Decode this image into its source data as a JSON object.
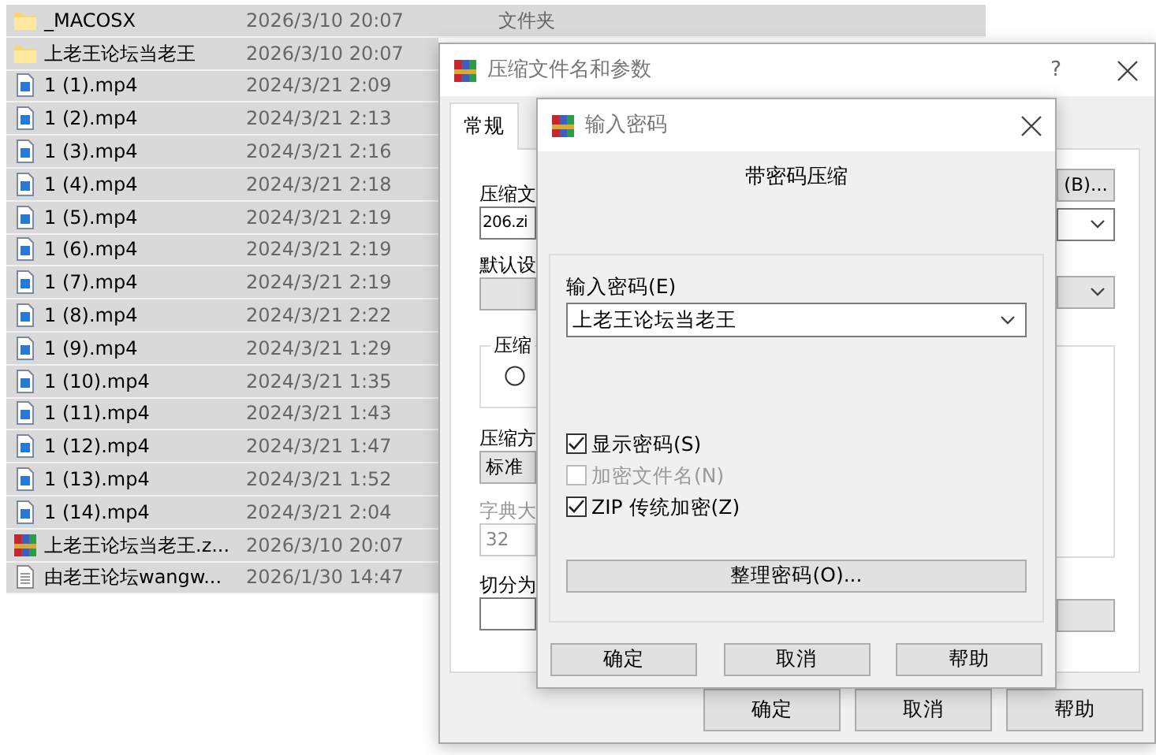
{
  "file_list": {
    "rows": [
      {
        "kind": "folder",
        "name": "_MACOSX",
        "modified": "2026/3/10 20:07",
        "type": "文件夹",
        "selected": true
      },
      {
        "kind": "folder",
        "name": "上老王论坛当老王",
        "modified": "2026/3/10 20:07",
        "selected": true
      },
      {
        "kind": "video",
        "name": "1 (1).mp4",
        "modified": "2024/3/21 2:09",
        "selected": true
      },
      {
        "kind": "video",
        "name": "1 (2).mp4",
        "modified": "2024/3/21 2:13",
        "selected": true
      },
      {
        "kind": "video",
        "name": "1 (3).mp4",
        "modified": "2024/3/21 2:16",
        "selected": true
      },
      {
        "kind": "video",
        "name": "1 (4).mp4",
        "modified": "2024/3/21 2:18",
        "selected": true
      },
      {
        "kind": "video",
        "name": "1 (5).mp4",
        "modified": "2024/3/21 2:19",
        "selected": true
      },
      {
        "kind": "video",
        "name": "1 (6).mp4",
        "modified": "2024/3/21 2:19",
        "selected": true
      },
      {
        "kind": "video",
        "name": "1 (7).mp4",
        "modified": "2024/3/21 2:19",
        "selected": true
      },
      {
        "kind": "video",
        "name": "1 (8).mp4",
        "modified": "2024/3/21 2:22",
        "selected": true
      },
      {
        "kind": "video",
        "name": "1 (9).mp4",
        "modified": "2024/3/21 1:29",
        "selected": true
      },
      {
        "kind": "video",
        "name": "1 (10).mp4",
        "modified": "2024/3/21 1:35",
        "selected": true
      },
      {
        "kind": "video",
        "name": "1 (11).mp4",
        "modified": "2024/3/21 1:43",
        "selected": true
      },
      {
        "kind": "video",
        "name": "1 (12).mp4",
        "modified": "2024/3/21 1:47",
        "selected": true
      },
      {
        "kind": "video",
        "name": "1 (13).mp4",
        "modified": "2024/3/21 1:52",
        "selected": true
      },
      {
        "kind": "video",
        "name": "1 (14).mp4",
        "modified": "2024/3/21 2:04",
        "selected": true
      },
      {
        "kind": "archive",
        "name": "上老王论坛当老王.z...",
        "modified": "2026/3/10 20:07",
        "selected": true
      },
      {
        "kind": "text",
        "name": "由老王论坛wangw...",
        "modified": "2026/1/30 14:47",
        "selected": true
      }
    ]
  },
  "archive_dialog": {
    "title": "压缩文件名和参数",
    "help_button": "?",
    "tabs": [
      {
        "label": "常规",
        "selected": true
      }
    ],
    "archive_name_label": "压缩文",
    "archive_name_value": "206.zi",
    "browse_button": "(B)...",
    "profile_label": "默认设",
    "format_group_label": "压缩",
    "format_radio": {
      "selected": false
    },
    "method_label": "压缩方",
    "method_value": "标准",
    "dictionary_label": "字典大",
    "dictionary_value": "32",
    "dictionary_disabled": true,
    "split_label": "切分为",
    "buttons": [
      "确定",
      "取消",
      "帮助"
    ]
  },
  "password_dialog": {
    "title": "输入密码",
    "heading": "带密码压缩",
    "password_label": "输入密码(E)",
    "password_value": "上老王论坛当老王",
    "options": [
      {
        "label": "显示密码(S)",
        "checked": true,
        "disabled": false
      },
      {
        "label": "加密文件名(N)",
        "checked": false,
        "disabled": true
      },
      {
        "label": "ZIP 传统加密(Z)",
        "checked": true,
        "disabled": false
      }
    ],
    "organize_button": "整理密码(O)...",
    "buttons": [
      "确定",
      "取消",
      "帮助"
    ]
  }
}
